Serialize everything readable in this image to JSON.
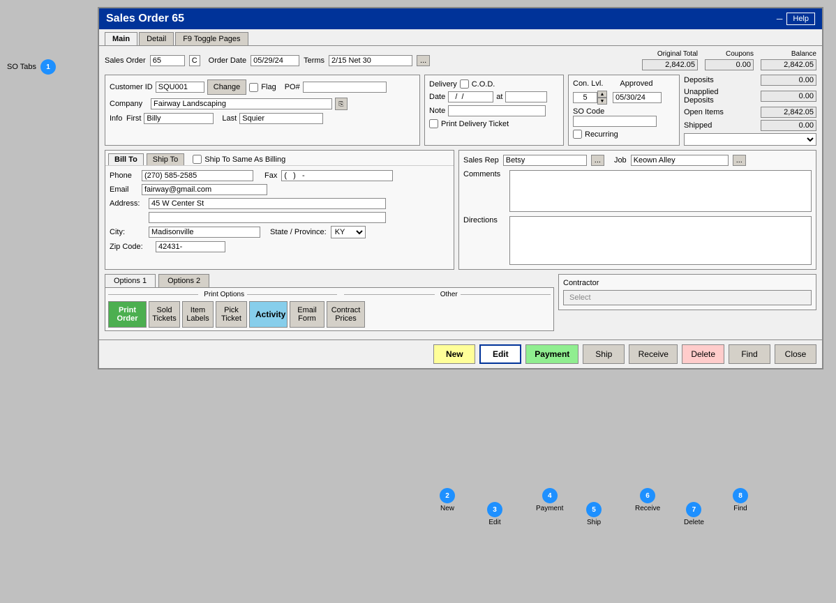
{
  "window": {
    "title": "Sales Order 65",
    "help_label": "Help"
  },
  "tabs": {
    "main_label": "Main",
    "detail_label": "Detail",
    "toggle_label": "F9 Toggle Pages"
  },
  "sales_order": {
    "label": "Sales Order",
    "number": "65",
    "c_label": "C",
    "order_date_label": "Order Date",
    "order_date": "05/29/24",
    "terms_label": "Terms",
    "terms": "2/15 Net 30",
    "terms_dots": "...",
    "original_total_label": "Original Total",
    "original_total": "2,842.05",
    "coupons_label": "Coupons",
    "coupons": "0.00",
    "balance_label": "Balance",
    "balance": "2,842.05"
  },
  "customer": {
    "id_label": "Customer ID",
    "id": "SQU001",
    "change_label": "Change",
    "flag_label": "Flag",
    "po_label": "PO#",
    "po_value": "",
    "company_label": "Company",
    "company": "Fairway Landscaping",
    "info_label": "Info",
    "first_label": "First",
    "first": "Billy",
    "last_label": "Last",
    "last": "Squier"
  },
  "delivery": {
    "label": "Delivery",
    "cod_label": "C.O.D.",
    "date_label": "Date",
    "date": "/  /",
    "at_label": "at",
    "at_value": "",
    "note_label": "Note",
    "note_value": "",
    "print_ticket_label": "Print Delivery Ticket"
  },
  "con_lvl": {
    "label": "Con. Lvl.",
    "value": "5",
    "approved_label": "Approved",
    "approved_date": "05/30/24",
    "so_code_label": "SO Code",
    "so_code": "",
    "recurring_label": "Recurring"
  },
  "deposits": {
    "deposits_label": "Deposits",
    "deposits_value": "0.00",
    "unapplied_label": "Unapplied",
    "unapplied_sub_label": "Deposits",
    "unapplied_value": "0.00",
    "open_items_label": "Open Items",
    "open_items_value": "2,842.05",
    "shipped_label": "Shipped",
    "shipped_value": "0.00"
  },
  "billing": {
    "bill_to_label": "Bill To",
    "ship_to_label": "Ship To",
    "same_as_billing_label": "Ship To Same As Billing",
    "phone_label": "Phone",
    "phone": "(270) 585-2585",
    "fax_label": "Fax",
    "fax": "(   )   -",
    "email_label": "Email",
    "email": "fairway@gmail.com",
    "address_label": "Address:",
    "address1": "45 W Center St",
    "address2": "",
    "city_label": "City:",
    "city": "Madisonville",
    "state_label": "State / Province:",
    "state": "KY",
    "zip_label": "Zip Code:",
    "zip": "42431-"
  },
  "sales_info": {
    "sales_rep_label": "Sales Rep",
    "sales_rep": "Betsy",
    "sales_rep_dots": "...",
    "job_label": "Job",
    "job": "Keown Alley",
    "job_dots": "...",
    "comments_label": "Comments",
    "comments": "",
    "directions_label": "Directions",
    "directions": ""
  },
  "options": {
    "tab1_label": "Options 1",
    "tab2_label": "Options 2",
    "print_options_label": "Print Options",
    "other_label": "Other",
    "print_order_label": "Print Order",
    "sold_tickets_label": "Sold Tickets",
    "item_labels_label": "Item Labels",
    "pick_ticket_label": "Pick Ticket",
    "activity_label": "Activity",
    "email_form_label": "Email Form",
    "contract_prices_label": "Contract Prices"
  },
  "contractor": {
    "label": "Contractor",
    "select_label": "Select"
  },
  "action_buttons": {
    "new_label": "New",
    "edit_label": "Edit",
    "payment_label": "Payment",
    "ship_label": "Ship",
    "receive_label": "Receive",
    "delete_label": "Delete",
    "find_label": "Find",
    "close_label": "Close"
  },
  "tooltips": {
    "so_tabs_label": "SO Tabs",
    "badge1": "1",
    "badge2": "2",
    "badge3": "3",
    "badge4": "4",
    "badge5": "5",
    "badge6": "6",
    "badge7": "7",
    "badge8": "8",
    "new_tip": "New",
    "edit_tip": "Edit",
    "payment_tip": "Payment",
    "ship_tip": "Ship",
    "receive_tip": "Receive",
    "delete_tip": "Delete",
    "find_tip": "Find"
  },
  "colors": {
    "title_bg": "#003399",
    "badge_bg": "#1e90ff"
  }
}
